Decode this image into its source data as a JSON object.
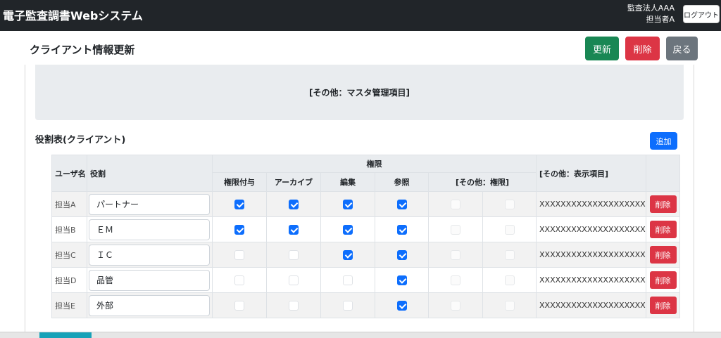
{
  "header": {
    "app_title": "電子監査調書Webシステム",
    "org": "監査法人AAA",
    "user": "担当者A",
    "logout_label": "ログアウト"
  },
  "page": {
    "title": "クライアント情報更新"
  },
  "actions": {
    "update": "更新",
    "delete": "削除",
    "back": "戻る"
  },
  "master_box": {
    "text": "[その他：マスタ管理項目]"
  },
  "roles_section": {
    "title": "役割表(クライアント)",
    "add_label": "追加"
  },
  "table": {
    "headers": {
      "user": "ユーザ名",
      "role": "役割",
      "permissions_group": "権限",
      "permissions": [
        "権限付与",
        "アーカイブ",
        "編集",
        "参照"
      ],
      "other_permissions": "[その他：権限]",
      "other_display": "[その他：表示項目]"
    },
    "rows": [
      {
        "user": "担当A",
        "role": "パートナー",
        "checks": [
          true,
          true,
          true,
          true,
          false,
          false
        ],
        "extra": "XXXXXXXXXXXXXXXXXXXX",
        "delete": "削除"
      },
      {
        "user": "担当B",
        "role": "ＥＭ",
        "checks": [
          true,
          true,
          true,
          true,
          false,
          false
        ],
        "extra": "XXXXXXXXXXXXXXXXXXXX",
        "delete": "削除"
      },
      {
        "user": "担当C",
        "role": "ＩＣ",
        "checks": [
          false,
          false,
          true,
          true,
          false,
          false
        ],
        "extra": "XXXXXXXXXXXXXXXXXXXX",
        "delete": "削除"
      },
      {
        "user": "担当D",
        "role": "品管",
        "checks": [
          false,
          false,
          false,
          true,
          false,
          false
        ],
        "extra": "XXXXXXXXXXXXXXXXXXXX",
        "delete": "削除"
      },
      {
        "user": "担当E",
        "role": "外部",
        "checks": [
          false,
          false,
          false,
          true,
          false,
          false
        ],
        "extra": "XXXXXXXXXXXXXXXXXXXX",
        "delete": "削除"
      }
    ]
  },
  "colors": {
    "navbar": "#212529",
    "primary": "#0d6efd",
    "success": "#198754",
    "danger": "#dc3545",
    "secondary": "#6c757d"
  }
}
